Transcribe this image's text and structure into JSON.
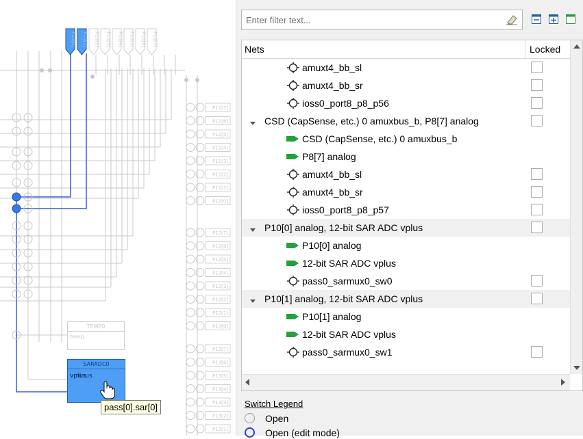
{
  "canvas": {
    "port_labels": [
      "P10[0]",
      "P10[1]",
      "P10[2]",
      "P10[3]",
      "P10[4]",
      "P10[5]",
      "P10[6]",
      "P10[7]"
    ],
    "side_pins_upper": [
      "P11[7]",
      "P11[6]",
      "P11[5]",
      "P11[4]",
      "P11[3]",
      "P11[2]",
      "P11[1]",
      "P11[0]"
    ],
    "side_pins_lower": [
      "P12[7]",
      "P12[6]",
      "P12[5]",
      "P12[4]",
      "P12[3]",
      "P12[2]",
      "P12[1]",
      "P12[0]"
    ],
    "side_pins_bottom": [
      "P13[7]",
      "P13[6]",
      "P13[5]",
      "P13[4]",
      "P13[3]",
      "P13[2]",
      "P13[1]"
    ],
    "temp_block": {
      "title": "TEMP0",
      "port": "temp"
    },
    "sar_block": {
      "title": "SARADC0",
      "port_vminus": "vminus",
      "port_vplus": "vplus"
    },
    "tooltip": "pass[0].sar[0]"
  },
  "filter": {
    "placeholder": "Enter filter text...",
    "value": ""
  },
  "table": {
    "header_nets": "Nets",
    "header_locked": "Locked",
    "rows": [
      {
        "label": "amuxt4_bb_sl",
        "icon": "switch-icon",
        "checkbox": true
      },
      {
        "label": "amuxt4_bb_sr",
        "icon": "switch-icon",
        "checkbox": true
      },
      {
        "label": "ioss0_port8_p8_p56",
        "icon": "switch-icon",
        "checkbox": true
      },
      {
        "label": "CSD (CapSense, etc.) 0 amuxbus_b, P8[7] analog",
        "icon": "expanded-caret-icon",
        "checkbox": true,
        "group": false
      },
      {
        "label": "CSD (CapSense, etc.) 0 amuxbus_b",
        "icon": "terminal-arrow-icon",
        "checkbox": false
      },
      {
        "label": "P8[7] analog",
        "icon": "terminal-arrow-icon",
        "checkbox": false
      },
      {
        "label": "amuxt4_bb_sl",
        "icon": "switch-icon",
        "checkbox": true
      },
      {
        "label": "amuxt4_bb_sr",
        "icon": "switch-icon",
        "checkbox": true
      },
      {
        "label": "ioss0_port8_p8_p57",
        "icon": "switch-icon",
        "checkbox": true
      },
      {
        "label": "P10[0] analog, 12-bit SAR ADC vplus",
        "icon": "expanded-caret-icon",
        "checkbox": true,
        "group": true
      },
      {
        "label": "P10[0] analog",
        "icon": "terminal-arrow-icon",
        "checkbox": false
      },
      {
        "label": "12-bit SAR ADC vplus",
        "icon": "terminal-arrow-icon",
        "checkbox": false
      },
      {
        "label": "pass0_sarmux0_sw0",
        "icon": "switch-icon",
        "checkbox": true
      },
      {
        "label": "P10[1] analog, 12-bit SAR ADC vplus",
        "icon": "expanded-caret-icon",
        "checkbox": true,
        "group": true
      },
      {
        "label": "P10[1] analog",
        "icon": "terminal-arrow-icon",
        "checkbox": false
      },
      {
        "label": "12-bit SAR ADC vplus",
        "icon": "terminal-arrow-icon",
        "checkbox": false
      },
      {
        "label": "pass0_sarmux0_sw1",
        "icon": "switch-icon",
        "checkbox": true
      }
    ]
  },
  "legend": {
    "title": "Switch Legend",
    "items": [
      {
        "label": "Open",
        "color": "#9a9a9a"
      },
      {
        "label": "Open (edit mode)",
        "color": "#2a3fd6"
      }
    ]
  },
  "colors": {
    "accent": "#4d9ef4",
    "wire_active": "#3b5bdb",
    "terminal_green": "#22a03c"
  }
}
